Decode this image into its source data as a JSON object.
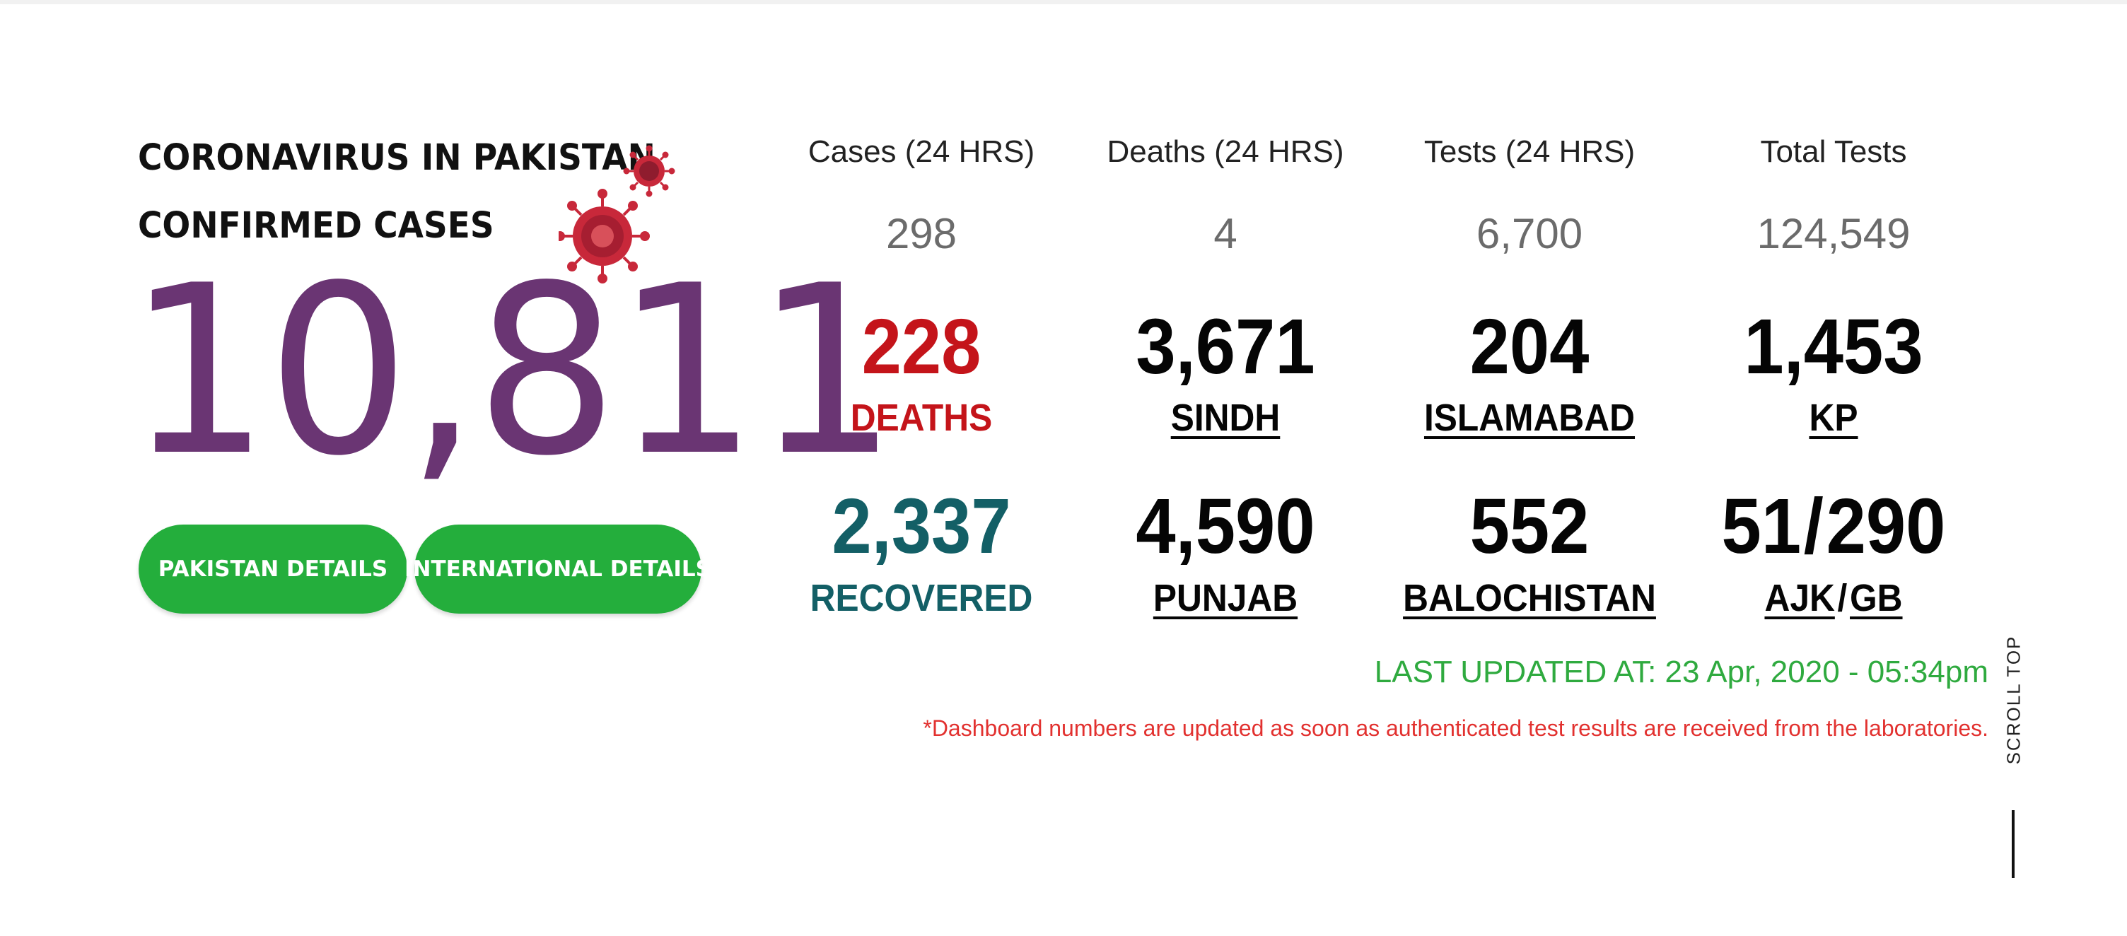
{
  "hero": {
    "title_line1": "CORONAVIRUS IN PAKISTAN",
    "title_line2": "CONFIRMED CASES",
    "confirmed_cases": "10,811",
    "buttons": {
      "pakistan": "PAKISTAN DETAILS",
      "international": "INTERNATIONAL DETAILS"
    },
    "virus_icon": "coronavirus-icon"
  },
  "daily": [
    {
      "label": "Cases (24 HRS)",
      "value": "298"
    },
    {
      "label": "Deaths (24 HRS)",
      "value": "4"
    },
    {
      "label": "Tests (24 HRS)",
      "value": "6,700"
    },
    {
      "label": "Total Tests",
      "value": "124,549"
    }
  ],
  "totals": {
    "deaths": {
      "value": "228",
      "label": "DEATHS"
    },
    "recovered": {
      "value": "2,337",
      "label": "RECOVERED"
    }
  },
  "regions": {
    "sindh": {
      "value": "3,671",
      "label": "SINDH"
    },
    "islamabad": {
      "value": "204",
      "label": "ISLAMABAD"
    },
    "kp": {
      "value": "1,453",
      "label": "KP"
    },
    "punjab": {
      "value": "4,590",
      "label": "PUNJAB"
    },
    "balochistan": {
      "value": "552",
      "label": "BALOCHISTAN"
    },
    "ajk_gb": {
      "value_ajk": "51",
      "slash": "/",
      "value_gb": "290",
      "label_ajk": "AJK",
      "label_gb": "GB"
    }
  },
  "footer": {
    "last_updated": "LAST UPDATED AT: 23 Apr, 2020 - 05:34pm",
    "note": "*Dashboard numbers are updated as soon as authenticated test results are received from the laboratories."
  },
  "scroll_top": "SCROLL TOP",
  "colors": {
    "purple": "#6a3573",
    "green": "#24ae3c",
    "red": "#c4141a",
    "teal": "#135f66",
    "updated_green": "#2faa3f",
    "note_red": "#e2312f",
    "virus_red": "#c8283a"
  }
}
